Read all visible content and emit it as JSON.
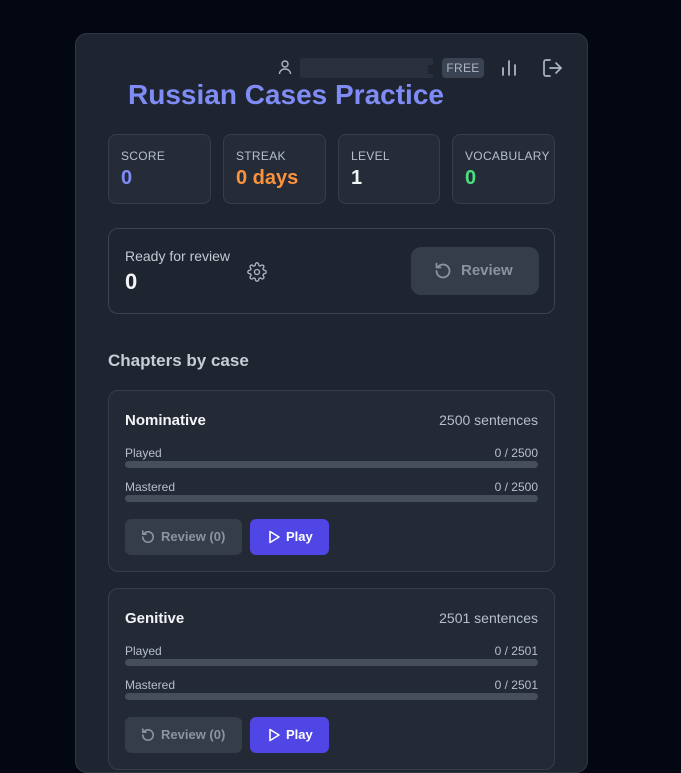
{
  "header": {
    "user_name": "",
    "plan_badge": "FREE",
    "title": "Russian Cases Practice",
    "icons": {
      "user": "user-icon",
      "stats": "bar-chart-icon",
      "logout": "logout-icon"
    }
  },
  "stats": [
    {
      "label": "SCORE",
      "value": "0",
      "color": "#7f8cf5"
    },
    {
      "label": "STREAK",
      "value": "0 days",
      "color": "#fb923c"
    },
    {
      "label": "LEVEL",
      "value": "1",
      "color": "#f3f4f6"
    },
    {
      "label": "VOCABULARY",
      "value": "0",
      "color": "#4ade80"
    }
  ],
  "review": {
    "label": "Ready for review",
    "count": "0",
    "button_label": "Review",
    "icons": {
      "settings": "gear-icon",
      "button": "refresh-icon"
    }
  },
  "chapters_title": "Chapters by case",
  "chapters": [
    {
      "name": "Nominative",
      "sentences": "2500 sentences",
      "played_label": "Played",
      "played_value": "0 / 2500",
      "played_progress": 0,
      "mastered_label": "Mastered",
      "mastered_value": "0 / 2500",
      "mastered_progress": 0,
      "review_label": "Review (0)",
      "play_label": "Play"
    },
    {
      "name": "Genitive",
      "sentences": "2501 sentences",
      "played_label": "Played",
      "played_value": "0 / 2501",
      "played_progress": 0,
      "mastered_label": "Mastered",
      "mastered_value": "0 / 2501",
      "mastered_progress": 0,
      "review_label": "Review (0)",
      "play_label": "Play"
    }
  ],
  "colors": {
    "background": "#030711",
    "panel": "#1e2430",
    "accent": "#4f46e5",
    "title": "#7f8cf5"
  }
}
